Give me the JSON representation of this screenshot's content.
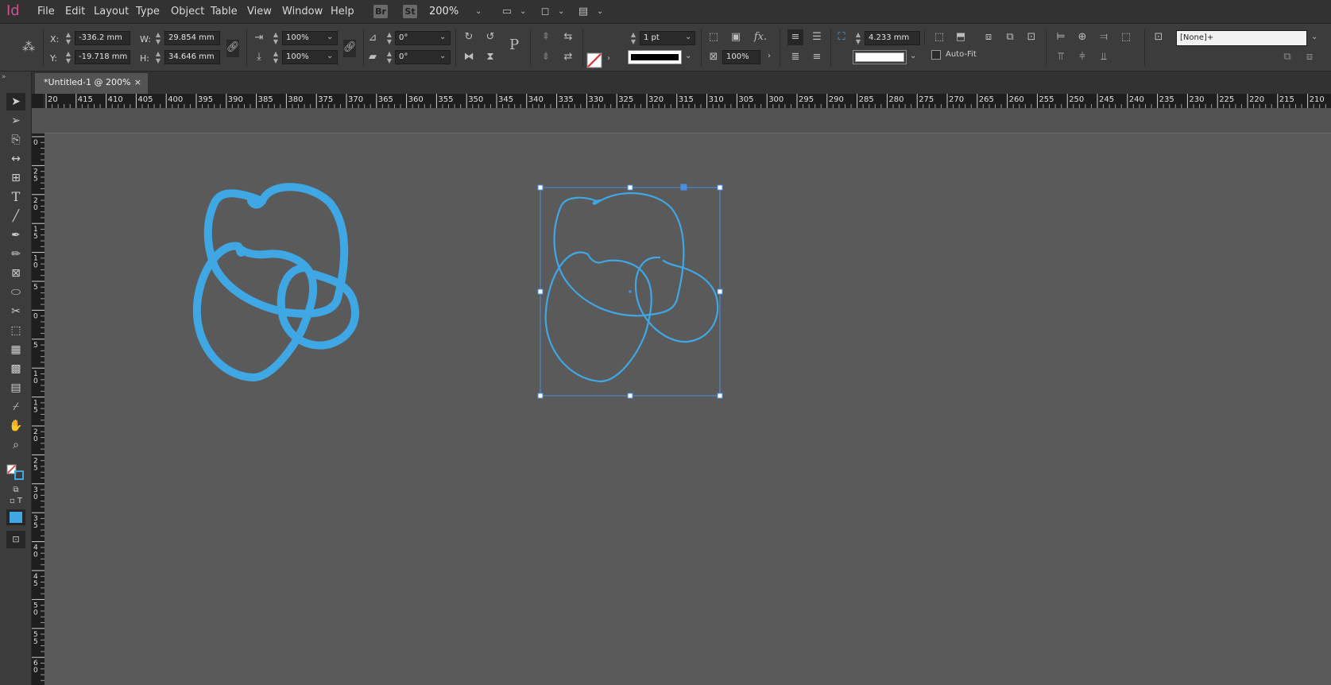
{
  "app": {
    "logo": "Id"
  },
  "menu": {
    "items": [
      "File",
      "Edit",
      "Layout",
      "Type",
      "Object",
      "Table",
      "View",
      "Window",
      "Help"
    ],
    "bridge": "Br",
    "stock": "St",
    "zoom": "200%"
  },
  "control": {
    "x_label": "X:",
    "x_value": "-336.2 mm",
    "y_label": "Y:",
    "y_value": "-19.718 mm",
    "w_label": "W:",
    "w_value": "29.854 mm",
    "h_label": "H:",
    "h_value": "34.646 mm",
    "scale_x": "100%",
    "scale_y": "100%",
    "rotate": "0°",
    "shear": "0°",
    "stroke_weight": "1 pt",
    "opacity": "100%",
    "offset": "4.233 mm",
    "autofit_label": "Auto-Fit",
    "object_style": "[None]+"
  },
  "tab": {
    "title": "*Untitled-1 @ 200%",
    "close": "×"
  },
  "ruler": {
    "h_ticks": [
      "20",
      "415",
      "410",
      "405",
      "400",
      "395",
      "390",
      "385",
      "380",
      "375",
      "370",
      "365",
      "360",
      "355",
      "350",
      "345",
      "340",
      "335",
      "330",
      "325",
      "320",
      "315",
      "310",
      "305",
      "300",
      "295",
      "290",
      "285",
      "280",
      "275",
      "270",
      "265",
      "260",
      "255",
      "250",
      "245",
      "240",
      "235",
      "230",
      "225",
      "220",
      "215",
      "210"
    ],
    "v_ticks": [
      "0",
      "25",
      "20",
      "15",
      "10",
      "5",
      "0",
      "5",
      "10",
      "15",
      "20",
      "25",
      "30",
      "35",
      "40",
      "45",
      "50",
      "55",
      "60"
    ]
  },
  "colors": {
    "stroke": "#3ea7e4",
    "selection": "#4a90e2",
    "canvas": "#5a5a5a"
  }
}
